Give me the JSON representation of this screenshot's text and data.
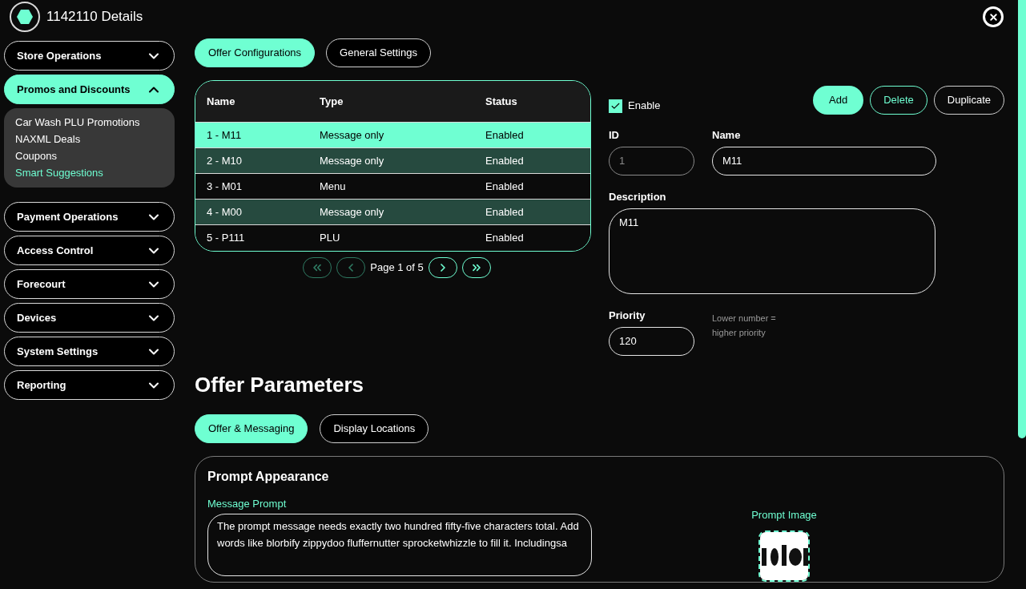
{
  "window": {
    "title": "1142110 Details"
  },
  "sidebar": {
    "sections": [
      {
        "label": "Store Operations",
        "expanded": false
      },
      {
        "label": "Promos and Discounts",
        "expanded": true,
        "items": [
          {
            "label": "Car Wash PLU Promotions",
            "selected": false
          },
          {
            "label": "NAXML Deals",
            "selected": false
          },
          {
            "label": "Coupons",
            "selected": false
          },
          {
            "label": "Smart Suggestions",
            "selected": true
          }
        ]
      },
      {
        "label": "Payment Operations",
        "expanded": false
      },
      {
        "label": "Access Control",
        "expanded": false
      },
      {
        "label": "Forecourt",
        "expanded": false
      },
      {
        "label": "Devices",
        "expanded": false
      },
      {
        "label": "System Settings",
        "expanded": false
      },
      {
        "label": "Reporting",
        "expanded": false
      }
    ]
  },
  "config_tabs": [
    {
      "label": "Offer Configurations",
      "selected": true
    },
    {
      "label": "General Settings",
      "selected": false
    }
  ],
  "offers_table": {
    "columns": [
      "Name",
      "Type",
      "Status"
    ],
    "rows": [
      {
        "cells": [
          "1 - M11",
          "Message only",
          "Enabled"
        ],
        "selected": true
      },
      {
        "cells": [
          "2 - M10",
          "Message only",
          "Enabled"
        ],
        "selected": false
      },
      {
        "cells": [
          "3 - M01",
          "Menu",
          "Enabled"
        ],
        "selected": false
      },
      {
        "cells": [
          "4 - M00",
          "Message only",
          "Enabled"
        ],
        "selected": false
      },
      {
        "cells": [
          "5 - P111",
          "PLU",
          "Enabled"
        ],
        "selected": false
      }
    ]
  },
  "pagination": {
    "label": "Page 1 of 5",
    "buttons": [
      {
        "kind": "first",
        "disabled": true
      },
      {
        "kind": "prev",
        "disabled": true
      },
      {
        "kind": "next",
        "disabled": false
      },
      {
        "kind": "last",
        "disabled": false
      }
    ]
  },
  "form": {
    "enable": {
      "label": "Enable",
      "checked": true
    },
    "actions": [
      {
        "label": "Add",
        "kind": "primary"
      },
      {
        "label": "Delete",
        "kind": "accent"
      },
      {
        "label": "Duplicate",
        "kind": "plain"
      }
    ],
    "id": {
      "label": "ID",
      "value": "1",
      "disabled": true
    },
    "name": {
      "label": "Name",
      "value": "M11"
    },
    "description": {
      "label": "Description",
      "value": "M11"
    },
    "priority": {
      "label": "Priority",
      "value": "120",
      "hint": "Lower number = higher priority"
    }
  },
  "offer_parameters": {
    "title": "Offer Parameters",
    "tabs": [
      {
        "label": "Offer & Messaging",
        "selected": true
      },
      {
        "label": "Display Locations",
        "selected": false
      }
    ],
    "card": {
      "title": "Prompt Appearance",
      "message_label": "Message Prompt",
      "message": "The prompt message needs exactly two hundred fifty-five characters total. Add words like blorbify zippydoo fluffernutter sprocketwhizzle to fill it. Includingsa",
      "image_label": "Prompt Image"
    }
  }
}
